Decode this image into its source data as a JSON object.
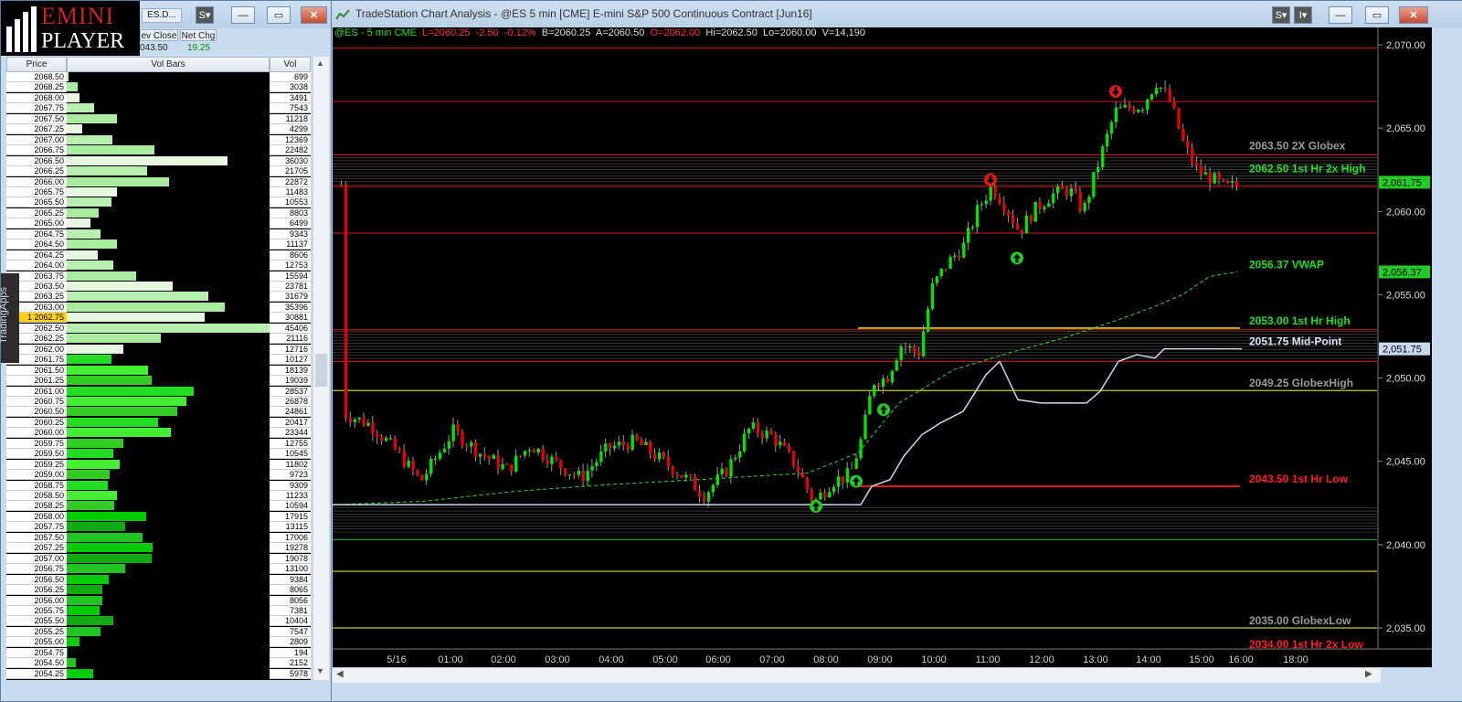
{
  "ladder": {
    "logo_line1": "EMINI",
    "logo_line2": "PLAYER",
    "symbol_frag": "ES.D...",
    "prev_close_label": "ev Close",
    "net_chg_label": "Net Chg",
    "prev_close_value": "043.50",
    "net_chg_value": "19.25",
    "col_price": "Price",
    "col_volbars": "Vol Bars",
    "col_vol": "Vol",
    "side_tab": "TradingApps",
    "current_marker": "1",
    "rows": [
      {
        "price": "2068.50",
        "vol": "699",
        "b": 2
      },
      {
        "price": "2068.25",
        "vol": "3038",
        "b": 12
      },
      {
        "price": "2068.00",
        "vol": "3491",
        "b": 14
      },
      {
        "price": "2067.75",
        "vol": "7543",
        "b": 30
      },
      {
        "price": "2067.50",
        "vol": "11218",
        "b": 55
      },
      {
        "price": "2067.25",
        "vol": "4299",
        "b": 17
      },
      {
        "price": "2067.00",
        "vol": "12369",
        "b": 50
      },
      {
        "price": "2066.75",
        "vol": "22482",
        "b": 96
      },
      {
        "price": "2066.50",
        "vol": "36030",
        "b": 176
      },
      {
        "price": "2066.25",
        "vol": "21705",
        "b": 88
      },
      {
        "price": "2066.00",
        "vol": "22872",
        "b": 112
      },
      {
        "price": "2065.75",
        "vol": "11483",
        "b": 55
      },
      {
        "price": "2065.50",
        "vol": "10553",
        "b": 49
      },
      {
        "price": "2065.25",
        "vol": "8803",
        "b": 35
      },
      {
        "price": "2065.00",
        "vol": "6499",
        "b": 26
      },
      {
        "price": "2064.75",
        "vol": "9343",
        "b": 37
      },
      {
        "price": "2064.50",
        "vol": "11137",
        "b": 55
      },
      {
        "price": "2064.25",
        "vol": "8606",
        "b": 34
      },
      {
        "price": "2064.00",
        "vol": "12753",
        "b": 51
      },
      {
        "price": "2063.75",
        "vol": "15594",
        "b": 76
      },
      {
        "price": "2063.50",
        "vol": "23781",
        "b": 116
      },
      {
        "price": "2063.25",
        "vol": "31679",
        "b": 155
      },
      {
        "price": "2063.00",
        "vol": "35396",
        "b": 173
      },
      {
        "price": "2062.75",
        "vol": "30881",
        "b": 151
      },
      {
        "price": "2062.50",
        "vol": "45406",
        "b": 222
      },
      {
        "price": "2062.25",
        "vol": "21116",
        "b": 103
      },
      {
        "price": "2062.00",
        "vol": "12716",
        "b": 62
      },
      {
        "price": "2061.75",
        "vol": "10127",
        "b": 49
      },
      {
        "price": "2061.50",
        "vol": "18139",
        "b": 89
      },
      {
        "price": "2061.25",
        "vol": "19039",
        "b": 93
      },
      {
        "price": "2061.00",
        "vol": "28537",
        "b": 139
      },
      {
        "price": "2060.75",
        "vol": "26878",
        "b": 131
      },
      {
        "price": "2060.50",
        "vol": "24861",
        "b": 121
      },
      {
        "price": "2060.25",
        "vol": "20417",
        "b": 100
      },
      {
        "price": "2060.00",
        "vol": "23344",
        "b": 114
      },
      {
        "price": "2059.75",
        "vol": "12755",
        "b": 62
      },
      {
        "price": "2059.50",
        "vol": "10545",
        "b": 51
      },
      {
        "price": "2059.25",
        "vol": "11802",
        "b": 58
      },
      {
        "price": "2059.00",
        "vol": "9723",
        "b": 47
      },
      {
        "price": "2058.75",
        "vol": "9309",
        "b": 45
      },
      {
        "price": "2058.50",
        "vol": "11233",
        "b": 55
      },
      {
        "price": "2058.25",
        "vol": "10594",
        "b": 52
      },
      {
        "price": "2058.00",
        "vol": "17915",
        "b": 87
      },
      {
        "price": "2057.75",
        "vol": "13115",
        "b": 64
      },
      {
        "price": "2057.50",
        "vol": "17006",
        "b": 83
      },
      {
        "price": "2057.25",
        "vol": "19278",
        "b": 94
      },
      {
        "price": "2057.00",
        "vol": "19078",
        "b": 93
      },
      {
        "price": "2056.75",
        "vol": "13100",
        "b": 64
      },
      {
        "price": "2056.50",
        "vol": "9384",
        "b": 46
      },
      {
        "price": "2056.25",
        "vol": "8065",
        "b": 39
      },
      {
        "price": "2056.00",
        "vol": "8056",
        "b": 39
      },
      {
        "price": "2055.75",
        "vol": "7381",
        "b": 36
      },
      {
        "price": "2055.50",
        "vol": "10404",
        "b": 51
      },
      {
        "price": "2055.25",
        "vol": "7547",
        "b": 37
      },
      {
        "price": "2055.00",
        "vol": "2809",
        "b": 14
      },
      {
        "price": "2054.75",
        "vol": "194",
        "b": 1
      },
      {
        "price": "2054.50",
        "vol": "2152",
        "b": 10
      },
      {
        "price": "2054.25",
        "vol": "5978",
        "b": 29
      }
    ]
  },
  "chart": {
    "title": "TradeStation Chart Analysis - @ES 5 min [CME] E-mini S&P 500 Continuous Contract [Jun16]",
    "status": {
      "sym": "@ES - 5 min  CME",
      "last": "L=2060.25",
      "chg": "-2.50",
      "pct": "-0.12%",
      "bid": "B=2060.25",
      "ask": "A=2060.50",
      "open": "O=2062.00",
      "high": "Hi=2062.50",
      "low": "Lo=2060.00",
      "vol": "V=14,190"
    },
    "price_labels": [
      "2,070.00",
      "2,065.00",
      "2,060.00",
      "2,055.00",
      "2,050.00",
      "2,045.00",
      "2,040.00",
      "2,035.00"
    ],
    "price_values": [
      2070,
      2065,
      2060,
      2055,
      2050,
      2045,
      2040,
      2035
    ],
    "last_tag": "2,061.75",
    "vwap_tag": "2,056.37",
    "mid_tag": "2,051.75",
    "time_labels": [
      "5/16",
      "01:00",
      "02:00",
      "03:00",
      "04:00",
      "05:00",
      "06:00",
      "07:00",
      "08:00",
      "09:00",
      "10:00",
      "11:00",
      "12:00",
      "13:00",
      "14:00",
      "15:00",
      "16:00",
      "18:00"
    ],
    "levels": [
      {
        "text": "2063.50 2X Globex",
        "value": 2063.5,
        "color": "#9a9a9a"
      },
      {
        "text": "2062.50 1st Hr  2x High",
        "value": 2062.5,
        "color": "#22dd22"
      },
      {
        "text": "2056.37 VWAP",
        "value": 2056.37,
        "color": "#22dd22"
      },
      {
        "text": "2053.00 1st Hr  High",
        "value": 2053.0,
        "color": "#22dd22"
      },
      {
        "text": "2051.75 Mid-Point",
        "value": 2051.75,
        "color": "#d8e6f5"
      },
      {
        "text": "2049.25 GlobexHigh",
        "value": 2049.25,
        "color": "#9a9a9a"
      },
      {
        "text": "2043.50 1st Hr  Low",
        "value": 2043.5,
        "color": "#ff2020"
      },
      {
        "text": "2035.00 GlobexLow",
        "value": 2035.0,
        "color": "#9a9a9a"
      },
      {
        "text": "2034.00 1st Hr  2x Low",
        "value": 2034.0,
        "color": "#ff2020"
      }
    ],
    "colors": {
      "up": "#00e000",
      "down": "#e00000",
      "vwap": "#22dd22",
      "midline": "#c8d8f0",
      "red_level": "#d81818",
      "yellow_level": "#c8c820"
    }
  }
}
